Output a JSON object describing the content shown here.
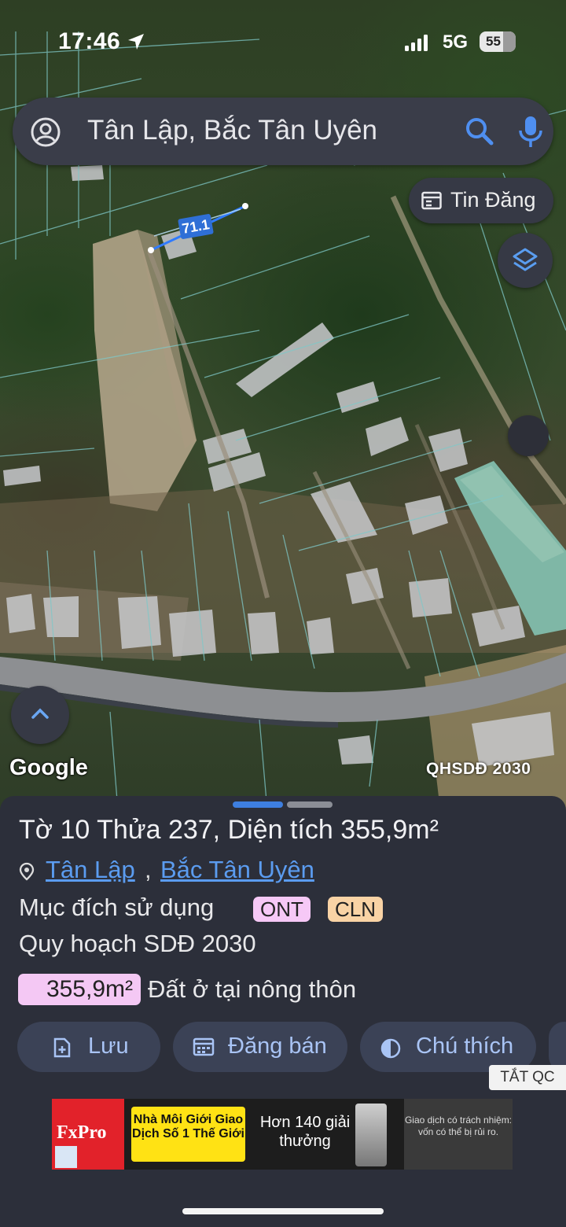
{
  "status_bar": {
    "time": "17:46",
    "network": "5G",
    "battery": "55"
  },
  "search": {
    "query": "Tân Lập, Bắc Tân Uyên",
    "icons": [
      "account-icon",
      "search-icon",
      "mic-icon"
    ]
  },
  "map": {
    "listing_button": "Tin Đăng",
    "measurement": "71.1",
    "google_label": "Google",
    "layer_label": "QHSDĐ 2030"
  },
  "sheet": {
    "title": "Tờ 10 Thửa 237, Diện tích 355,9m²",
    "location_links": [
      "Tân Lập",
      "Bắc Tân Uyên"
    ],
    "comma": ",",
    "purpose_label": "Mục đích sử dụng",
    "tags": [
      {
        "code": "ONT",
        "color": "#f6c8f6"
      },
      {
        "code": "CLN",
        "color": "#f9d3a5"
      }
    ],
    "plan_label": "Quy hoạch SDĐ 2030",
    "area_value": "355,9m²",
    "area_desc": "Đất ở tại nông thôn",
    "actions": [
      {
        "label": "Lưu",
        "icon": "add-doc-icon"
      },
      {
        "label": "Đăng bán",
        "icon": "calendar-icon"
      },
      {
        "label": "Chú thích",
        "icon": "contrast-icon"
      }
    ],
    "ad_off": "TẮT QC"
  },
  "ad": {
    "brand": "FxPro",
    "badge": "Nhà Môi Giới Giao Dịch Số 1 Thế Giới",
    "middle": "Hơn 140 giải thưởng",
    "disclaimer": "Giao dịch có trách nhiệm: vốn có thể bị rủi ro."
  },
  "colors": {
    "accent": "#5b9cf0",
    "sheet_bg": "#2c2f3a",
    "button_bg": "#3b4256"
  }
}
